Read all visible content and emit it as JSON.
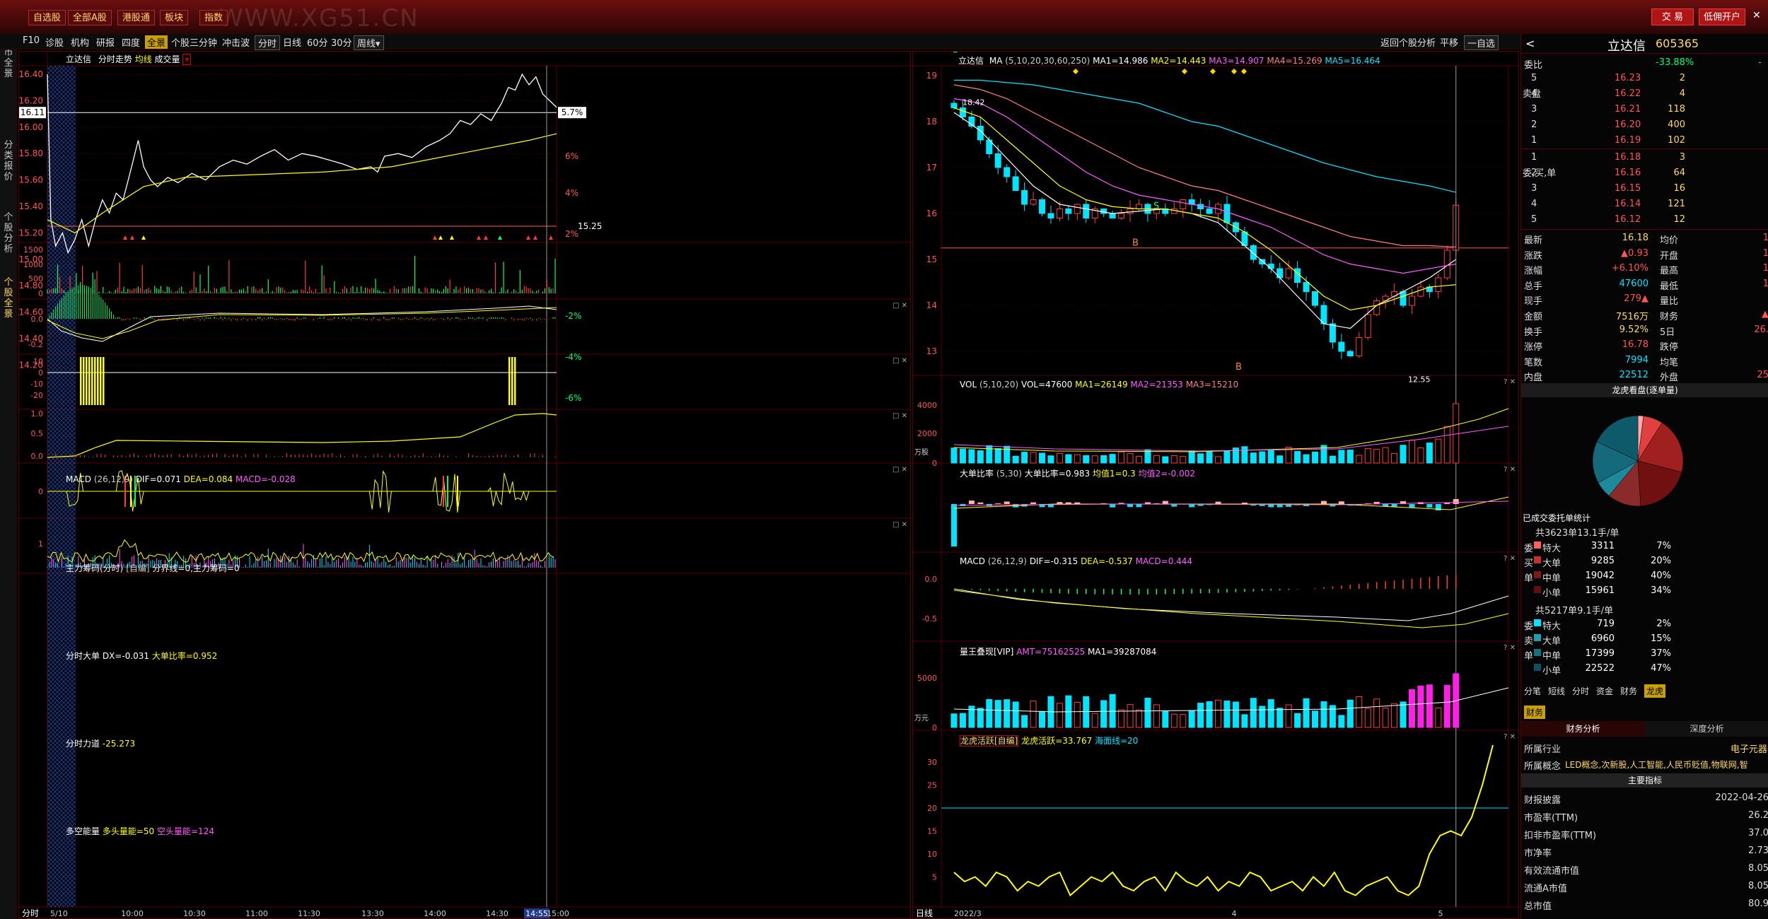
{
  "topbar": {
    "watermark": "WWW.XG51.CN",
    "buttons": [
      "自选股",
      "全部A股",
      "港股通",
      "板块",
      "指数"
    ],
    "right_buttons": [
      "交 易",
      "低佣开户"
    ],
    "close": "✕"
  },
  "sidetabs": [
    "股市全景",
    "分类报价",
    "个股分析",
    "个股全景"
  ],
  "toolbar": {
    "items": [
      "F10",
      "诊股",
      "机构",
      "研报",
      "四度",
      "全景",
      "个股三分钟",
      "冲击波",
      "分时",
      "日线",
      "60分",
      "30分",
      "周线▾"
    ],
    "right": [
      "返回个股分析",
      "平移",
      "一自选"
    ]
  },
  "intraday": {
    "title": "立达信",
    "subtitle": "分时走势",
    "avg_label": "均线",
    "vol_label": "成交量",
    "price_ticks": [
      "16.40",
      "16.20",
      "16.00",
      "15.80",
      "15.60",
      "15.40",
      "15.20",
      "15.00",
      "14.80",
      "14.60",
      "14.40",
      "14.20"
    ],
    "pct_ticks": [
      "6%",
      "4%",
      "2%",
      "-2%",
      "-4%",
      "-6%"
    ],
    "current_price": "16.11",
    "current_pct": "5.7%",
    "prev_close": "15.25",
    "time_ticks": [
      "5/10",
      "10:00",
      "10:30",
      "11:00",
      "11:30",
      "13:30",
      "14:00",
      "14:30",
      "14:55",
      "15:00"
    ],
    "corner": "分时",
    "vol_ticks": [
      "1500",
      "1000",
      "500",
      "0"
    ],
    "macd": {
      "name": "MACD",
      "params": "(26,12,9)",
      "dif": "DIF=0.071",
      "dea": "DEA=0.084",
      "macd": "MACD=-0.028",
      "ticks": [
        "0.0",
        "-0.2"
      ]
    },
    "zlcm": {
      "name": "主力筹码(分时)",
      "text": "[自编]",
      "extra": "分界线=0,主力筹码=0",
      "ticks": [
        "10",
        "0",
        "-10",
        "-20"
      ]
    },
    "fsdd": {
      "name": "分时大单",
      "text": "DX=-0.031",
      "extra": "大单比率=0.952",
      "ticks": [
        "1.0",
        "0.5",
        "0.0"
      ]
    },
    "fsld": {
      "name": "分时力道",
      "text": "-25.273",
      "ticks": [
        "0"
      ]
    },
    "dkn": {
      "name": "多空能量",
      "text": "多头量能=50",
      "extra": "空头量能=124",
      "ticks": [
        "1"
      ]
    }
  },
  "daily": {
    "title": "立达信",
    "ma_label": "MA",
    "ma_params": "(5,10,20,30,60,250)",
    "ma": [
      "MA1=14.986",
      "MA2=14.443",
      "MA3=14.907",
      "MA4=15.269",
      "MA5=16.464"
    ],
    "price_ticks": [
      "19",
      "18",
      "17",
      "16",
      "15",
      "14",
      "13"
    ],
    "high_mark": "18.42",
    "low_mark": "12.55",
    "date_ticks": [
      "2022/3",
      "4",
      "5"
    ],
    "corner": "日线",
    "vol": {
      "name": "VOL",
      "params": "(5,10,20)",
      "text": "VOL=47600",
      "ma1": "MA1=26149",
      "ma2": "MA2=21353",
      "ma3": "MA3=15210",
      "ticks": [
        "4000",
        "2000",
        "0"
      ],
      "unit": "万股"
    },
    "ddbl": {
      "name": "大单比率",
      "params": "(5,30)",
      "text": "大单比率=0.983",
      "j1": "均值1=0.3",
      "j2": "均值2=-0.002"
    },
    "macd": {
      "name": "MACD",
      "params": "(26,12,9)",
      "dif": "DIF=-0.315",
      "dea": "DEA=-0.537",
      "macd": "MACD=0.444",
      "ticks": [
        "0.0",
        "-0.5"
      ]
    },
    "lwdx": {
      "name": "量王叠现[VIP]",
      "text": "AMT=75162525",
      "ma1": "MA1=39287084",
      "ticks": [
        "5000",
        "0"
      ],
      "unit": "万元"
    },
    "lhhy": {
      "name": "龙虎活跃[自编]",
      "text": "龙虎活跃=33.767",
      "extra": "海面线=20",
      "ticks": [
        "30",
        "25",
        "20",
        "15",
        "10",
        "5"
      ]
    }
  },
  "quote": {
    "name": "立达信",
    "code": "605365",
    "webi": {
      "label": "委比",
      "value": "-33.88%",
      "extra": "-"
    },
    "sell": [
      {
        "lv": "5",
        "price": "16.23",
        "vol": "2"
      },
      {
        "lv": "4",
        "price": "16.22",
        "vol": "4"
      },
      {
        "lv": "3",
        "price": "16.21",
        "vol": "118"
      },
      {
        "lv": "2",
        "price": "16.20",
        "vol": "400"
      },
      {
        "lv": "1",
        "price": "16.19",
        "vol": "102"
      }
    ],
    "buy": [
      {
        "lv": "1",
        "price": "16.18",
        "vol": "3"
      },
      {
        "lv": "2",
        "price": "16.16",
        "vol": "64"
      },
      {
        "lv": "3",
        "price": "16.15",
        "vol": "16"
      },
      {
        "lv": "4",
        "price": "16.14",
        "vol": "121"
      },
      {
        "lv": "5",
        "price": "16.12",
        "vol": "12"
      }
    ],
    "sell_side": "卖盘",
    "buy_side": [
      "委",
      "买",
      "单"
    ],
    "stats": [
      {
        "l": "最新",
        "v": "16.18",
        "l2": "均价",
        "v2": "1"
      },
      {
        "l": "涨跌",
        "v": "▲0.93",
        "l2": "开盘",
        "v2": "1"
      },
      {
        "l": "涨幅",
        "v": "+6.10%",
        "l2": "最高",
        "v2": "1"
      },
      {
        "l": "总手",
        "v": "47600",
        "l2": "最低",
        "v2": "1"
      },
      {
        "l": "现手",
        "v": "279▲",
        "l2": "量比",
        "v2": ""
      },
      {
        "l": "金额",
        "v": "7516万",
        "l2": "财务",
        "v2": "▲"
      },
      {
        "l": "换手",
        "v": "9.52%",
        "l2": "5日",
        "v2": "26."
      },
      {
        "l": "涨停",
        "v": "16.78",
        "l2": "跌停",
        "v2": ""
      },
      {
        "l": "笔数",
        "v": "7994",
        "l2": "均笔",
        "v2": ""
      },
      {
        "l": "内盘",
        "v": "22512",
        "l2": "外盘",
        "v2": "25"
      }
    ],
    "pie_title": "龙虎看盘(逐单量)",
    "tjt": "已成交委托单统计",
    "buy_total": "共3623单13.1手/单",
    "buy_orders": [
      {
        "n": "特大",
        "v": "3311",
        "p": "7%"
      },
      {
        "n": "大单",
        "v": "9285",
        "p": "20%"
      },
      {
        "n": "中单",
        "v": "19042",
        "p": "40%"
      },
      {
        "n": "小单",
        "v": "15961",
        "p": "34%"
      }
    ],
    "sell_total": "共5217单9.1手/单",
    "sell_side2": [
      "委",
      "卖",
      "单"
    ],
    "sell_orders": [
      {
        "n": "特大",
        "v": "719",
        "p": "2%"
      },
      {
        "n": "大单",
        "v": "6960",
        "p": "15%"
      },
      {
        "n": "中单",
        "v": "17399",
        "p": "37%"
      },
      {
        "n": "小单",
        "v": "22522",
        "p": "47%"
      }
    ],
    "tabs": [
      "分笔",
      "短线",
      "分时",
      "资金",
      "财务",
      "龙虎"
    ],
    "fin_tab": "财务",
    "sub_tabs": [
      "财务分析",
      "深度分析"
    ],
    "industry": {
      "l": "所属行业",
      "v": "电子元器"
    },
    "concept": {
      "l": "所属概念",
      "v": "LED概念,次新股,人工智能,人民币贬值,物联网,智"
    },
    "main_idx": "主要指标",
    "metrics": [
      {
        "l": "财报披露",
        "v": "2022-04-26"
      },
      {
        "l": "市盈率(TTM)",
        "v": "26.2"
      },
      {
        "l": "扣非市盈率(TTM)",
        "v": "37.0"
      },
      {
        "l": "市净率",
        "v": "2.73"
      },
      {
        "l": "有效流通市值",
        "v": "8.05"
      },
      {
        "l": "流通A市值",
        "v": "8.05"
      },
      {
        "l": "总市值",
        "v": "80.9"
      }
    ]
  },
  "colors": {
    "up": "#ff3b3b",
    "down": "#00e5ff",
    "yellow": "#ffff00",
    "gold": "#ffd966",
    "bg": "#000000",
    "border": "#5a0000"
  }
}
